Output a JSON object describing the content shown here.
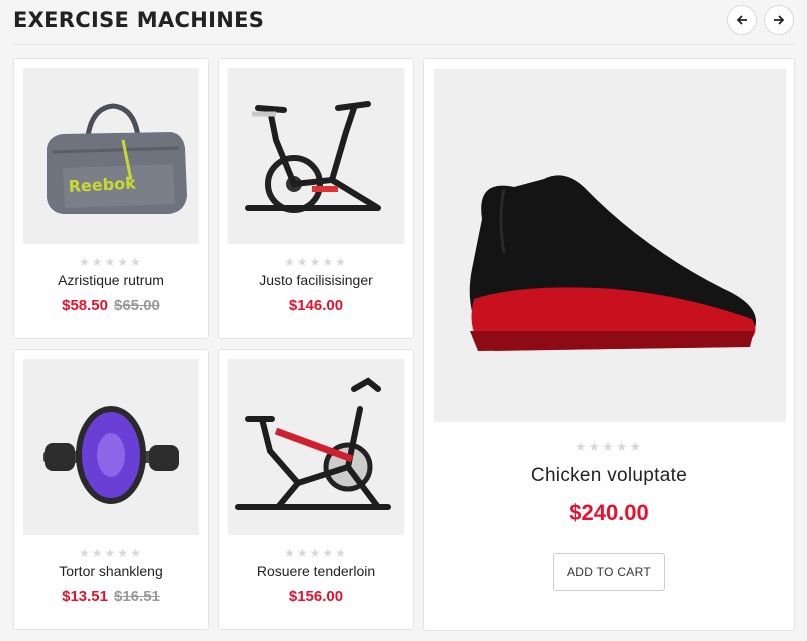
{
  "section": {
    "title": "EXERCISE MACHINES"
  },
  "nav": {
    "prev_icon": "arrow-left-icon",
    "next_icon": "arrow-right-icon"
  },
  "rating_stars": "★★★★★",
  "products": [
    {
      "name": "Azristique rutrum",
      "price": "$58.50",
      "old_price": "$65.00",
      "image": "duffel-bag"
    },
    {
      "name": "Justo facilisisinger",
      "price": "$146.00",
      "old_price": "",
      "image": "exercise-bike"
    },
    {
      "name": "Tortor shankleng",
      "price": "$13.51",
      "old_price": "$16.51",
      "image": "ab-wheel"
    },
    {
      "name": "Rosuere tenderloin",
      "price": "$156.00",
      "old_price": "",
      "image": "exercise-bike-2"
    }
  ],
  "featured": {
    "name": "Chicken voluptate",
    "price": "$240.00",
    "cart_label": "ADD TO CART",
    "image": "sneaker"
  },
  "colors": {
    "accent": "#e8112d",
    "old_price": "#9a9a9a"
  }
}
